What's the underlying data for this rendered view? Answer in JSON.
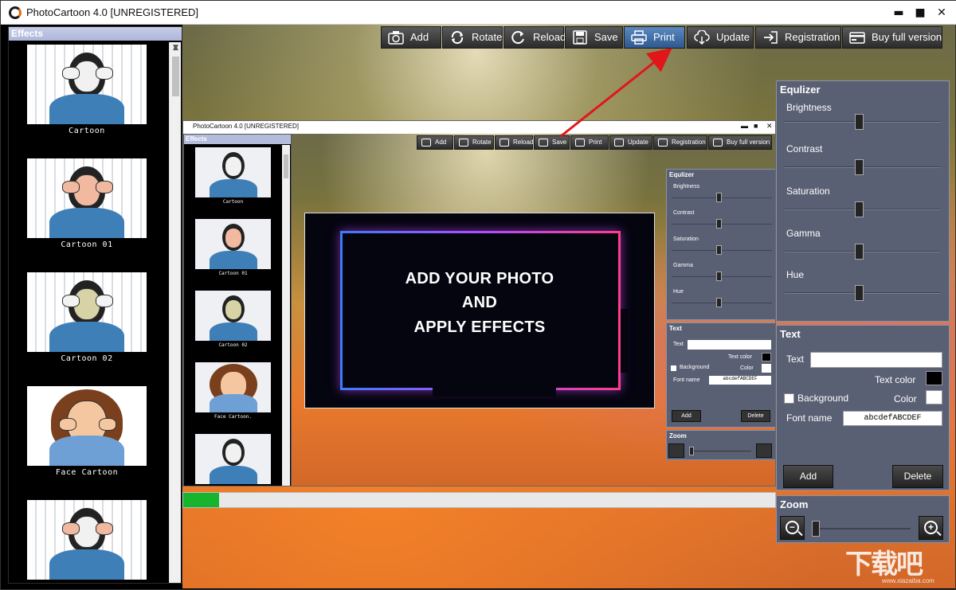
{
  "window": {
    "title": "PhotoCartoon 4.0 [UNREGISTERED]",
    "minimize": "▬",
    "maximize": "■",
    "close": "✕"
  },
  "effects": {
    "header": "Effects",
    "items": [
      {
        "label": "Cartoon"
      },
      {
        "label": "Cartoon 01"
      },
      {
        "label": "Cartoon 02"
      },
      {
        "label": "Face Cartoon"
      },
      {
        "label": ""
      }
    ]
  },
  "toolbar": {
    "add": "Add",
    "rotate": "Rotate",
    "reload": "Reload",
    "save": "Save",
    "print": "Print",
    "update": "Update",
    "registration": "Registration",
    "buy": "Buy full version",
    "active": "print"
  },
  "equalizer": {
    "title": "Equlizer",
    "brightness": "Brightness",
    "contrast": "Contrast",
    "saturation": "Saturation",
    "gamma": "Gamma",
    "hue": "Hue",
    "levels": {
      "brightness": 0.5,
      "contrast": 0.5,
      "saturation": 0.5,
      "gamma": 0.5,
      "hue": 0.5
    }
  },
  "text_panel": {
    "title": "Text",
    "text_label": "Text",
    "text_value": "",
    "text_color_label": "Text color",
    "text_color": "#000000",
    "background_label": "Background",
    "background_checked": false,
    "color_label": "Color",
    "color": "#ffffff",
    "font_name_label": "Font name",
    "font_name_value": "abcdefABCDEF",
    "add": "Add",
    "delete": "Delete"
  },
  "zoom": {
    "title": "Zoom",
    "level": 0.0
  },
  "progress": {
    "value": 0.06
  },
  "preview": {
    "line1": "ADD YOUR PHOTO",
    "line2": "AND",
    "line3": "APPLY EFFECTS"
  },
  "inner": {
    "title": "PhotoCartoon 4.0 [UNREGISTERED]",
    "effects_header": "Effects",
    "labels": [
      "Cartoon",
      "Cartoon 01",
      "Cartoon 02",
      "Face Cartoon.",
      ""
    ],
    "toolbar": [
      "Add",
      "Rotate",
      "Reload",
      "Save",
      "Print",
      "Update",
      "Registration",
      "Buy full version"
    ],
    "eq_title": "Equlizer",
    "eq": [
      "Brightness",
      "Contrast",
      "Saturation",
      "Gamma",
      "Hue"
    ],
    "text_title": "Text",
    "text_label": "Text",
    "text_color_label": "Text color",
    "background_label": "Background",
    "color_label": "Color",
    "font_name_label": "Font name",
    "font_value": "abcdefABCDEF",
    "add": "Add",
    "delete": "Delete",
    "zoom_title": "Zoom"
  },
  "watermark": {
    "text": "下载吧",
    "url": "www.xiazaiba.com"
  },
  "colors": {
    "accent_active": "#3d6fae",
    "panel": "#5a6074",
    "progress": "#17b52e",
    "arrow": "#e0161b"
  }
}
